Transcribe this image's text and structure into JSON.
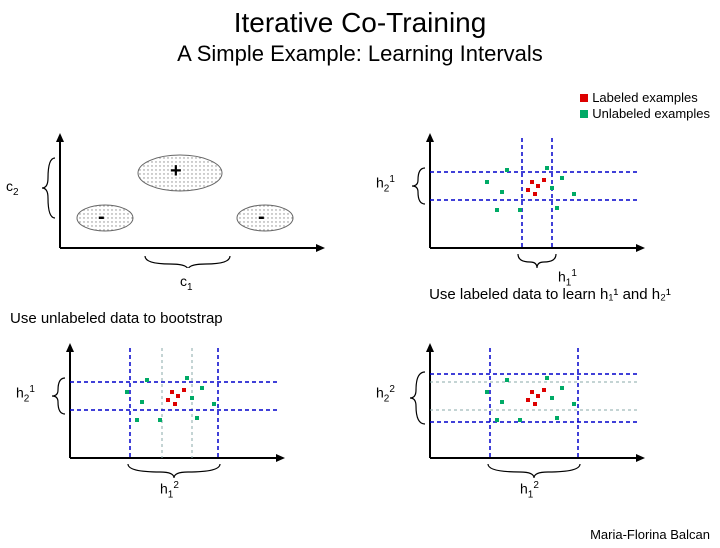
{
  "title": "Iterative Co-Training",
  "subtitle": "A Simple Example: Learning Intervals",
  "legend": {
    "labeled": "Labeled examples",
    "unlabeled": "Unlabeled examples"
  },
  "panels": {
    "p1": {
      "y_label": "c",
      "y_sub": "2",
      "x_label": "c",
      "x_sub": "1",
      "plus": "+",
      "minus": "-"
    },
    "p2": {
      "y_label": "h",
      "y_sub": "2",
      "y_sup": "1",
      "x_label": "h",
      "x_sub": "1",
      "x_sup": "1"
    },
    "p3": {
      "y_label": "h",
      "y_sub": "2",
      "y_sup": "1",
      "x_label": "h",
      "x_sub": "1",
      "x_sup": "2"
    },
    "p4": {
      "y_label": "h",
      "y_sub": "2",
      "y_sup": "2",
      "x_label": "h",
      "x_sub": "1",
      "x_sup": "2"
    }
  },
  "captions": {
    "right_top": "Use labeled data to learn h₁¹ and h₂¹",
    "left_mid": "Use unlabeled data to bootstrap"
  },
  "credit": "Maria-Florina Balcan",
  "chart_data": {
    "type": "diagram",
    "description": "Four schematic 2D panels illustrating iterative co-training on intervals.",
    "labeled_points_color": "red",
    "unlabeled_points_color": "green",
    "panels": [
      {
        "id": "p1",
        "axes": {
          "x": "c1",
          "y": "c2"
        },
        "regions": [
          {
            "label": "+",
            "shape": "ellipse",
            "cx": 0.48,
            "cy": 0.35,
            "rx": 0.14,
            "ry": 0.1
          },
          {
            "label": "-",
            "shape": "ellipse",
            "cx": 0.18,
            "cy": 0.62,
            "rx": 0.1,
            "ry": 0.07
          },
          {
            "label": "-",
            "shape": "ellipse",
            "cx": 0.8,
            "cy": 0.62,
            "rx": 0.1,
            "ry": 0.07
          }
        ]
      },
      {
        "id": "p2",
        "axes": {
          "x": "h1^1",
          "y": "h2^1"
        },
        "interval_x": [
          0.44,
          0.6
        ],
        "interval_y": [
          0.3,
          0.55
        ],
        "labeled_points": [
          [
            0.5,
            0.4
          ],
          [
            0.53,
            0.43
          ],
          [
            0.47,
            0.45
          ],
          [
            0.56,
            0.38
          ],
          [
            0.51,
            0.48
          ]
        ],
        "unlabeled_points": [
          [
            0.3,
            0.42
          ],
          [
            0.35,
            0.6
          ],
          [
            0.65,
            0.35
          ],
          [
            0.7,
            0.5
          ],
          [
            0.4,
            0.3
          ],
          [
            0.62,
            0.58
          ],
          [
            0.46,
            0.58
          ],
          [
            0.55,
            0.3
          ],
          [
            0.38,
            0.48
          ],
          [
            0.6,
            0.45
          ]
        ]
      },
      {
        "id": "p3",
        "axes": {
          "x": "h1^2",
          "y": "h2^1"
        },
        "interval_x": [
          0.3,
          0.72
        ],
        "interval_y": [
          0.3,
          0.55
        ],
        "labeled_points": [
          [
            0.5,
            0.4
          ],
          [
            0.53,
            0.43
          ],
          [
            0.47,
            0.45
          ],
          [
            0.56,
            0.38
          ],
          [
            0.51,
            0.48
          ]
        ],
        "unlabeled_points": [
          [
            0.3,
            0.42
          ],
          [
            0.35,
            0.6
          ],
          [
            0.65,
            0.35
          ],
          [
            0.7,
            0.5
          ],
          [
            0.4,
            0.3
          ],
          [
            0.62,
            0.58
          ],
          [
            0.46,
            0.58
          ],
          [
            0.55,
            0.3
          ],
          [
            0.38,
            0.48
          ],
          [
            0.6,
            0.45
          ]
        ]
      },
      {
        "id": "p4",
        "axes": {
          "x": "h1^2",
          "y": "h2^2"
        },
        "interval_x": [
          0.3,
          0.72
        ],
        "interval_y": [
          0.26,
          0.62
        ],
        "labeled_points": [
          [
            0.5,
            0.4
          ],
          [
            0.53,
            0.43
          ],
          [
            0.47,
            0.45
          ],
          [
            0.56,
            0.38
          ],
          [
            0.51,
            0.48
          ]
        ],
        "unlabeled_points": [
          [
            0.3,
            0.42
          ],
          [
            0.35,
            0.6
          ],
          [
            0.65,
            0.35
          ],
          [
            0.7,
            0.5
          ],
          [
            0.4,
            0.3
          ],
          [
            0.62,
            0.58
          ],
          [
            0.46,
            0.58
          ],
          [
            0.55,
            0.3
          ],
          [
            0.38,
            0.48
          ],
          [
            0.6,
            0.45
          ]
        ]
      }
    ]
  }
}
